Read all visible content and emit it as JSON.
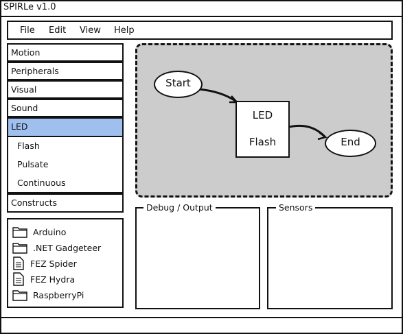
{
  "app": {
    "title": "SPIRLe v1.0"
  },
  "menu": [
    "File",
    "Edit",
    "View",
    "Help"
  ],
  "palette": {
    "categories": [
      "Motion",
      "Peripherals",
      "Visual",
      "Sound",
      "LED"
    ],
    "selected": "LED",
    "led_items": [
      "Flash",
      "Pulsate",
      "Continuous"
    ],
    "constructs": "Constructs"
  },
  "project_tree": [
    {
      "label": "Arduino",
      "icon": "folder-icon"
    },
    {
      "label": ".NET Gadgeteer",
      "icon": "folder-icon"
    },
    {
      "label": "FEZ Spider",
      "icon": "document-icon"
    },
    {
      "label": "FEZ Hydra",
      "icon": "document-icon"
    },
    {
      "label": "RaspberryPi",
      "icon": "folder-icon"
    }
  ],
  "canvas": {
    "start": "Start",
    "block_line1": "LED",
    "block_line2": "Flash",
    "end": "End"
  },
  "panels": {
    "debug": "Debug / Output",
    "sensors": "Sensors"
  }
}
